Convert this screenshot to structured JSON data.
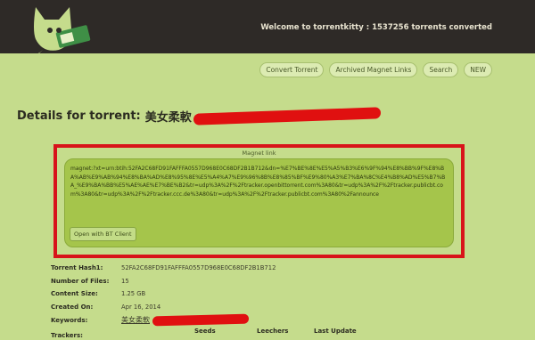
{
  "header": {
    "welcome": "Welcome to torrentkitty : 1537256 torrents converted"
  },
  "nav": {
    "items": [
      {
        "label": "Convert Torrent"
      },
      {
        "label": "Archived Magnet Links"
      },
      {
        "label": "Search"
      },
      {
        "label": "NEW"
      }
    ]
  },
  "page": {
    "title_label": "Details for torrent:",
    "torrent_name": "美女柔軟"
  },
  "magnet": {
    "caption": "Magnet link",
    "link": "magnet:?xt=urn:btih:52FA2C68FD91FAFFFA0557D968E0C68DF2B1B712&dn=%E7%BE%8E%E5%A5%B3%E6%9F%94%E8%BB%9F%E8%BA%AB%E9%AB%94%E8%BA%AD%E8%95%8E%E5%A4%A7%E9%96%8B%E8%85%BF%E9%80%A3%E7%BA%8C%E4%B8%AD%E5%B7%BA_%E9%BA%BB%E5%AE%AE%E7%BE%B2&tr=udp%3A%2F%2Ftracker.openbittorrent.com%3A80&tr=udp%3A%2F%2Ftracker.publicbt.com%3A80&tr=udp%3A%2F%2Ftracker.ccc.de%3A80&tr=udp%3A%2F%2Ftracker.publicbt.com%3A80%2Fannounce",
    "open_button": "Open with BT Client"
  },
  "details": {
    "hash_label": "Torrent Hash1:",
    "hash_value": "52FA2C68FD91FAFFFA0557D968E0C68DF2B1B712",
    "files_label": "Number of Files:",
    "files_value": "15",
    "size_label": "Content Size:",
    "size_value": "1.25 GB",
    "created_label": "Created On:",
    "created_value": "Apr 16, 2014",
    "keywords_label": "Keywords:",
    "keywords_value": "美女柔軟"
  },
  "trackers": {
    "label": "Trackers:",
    "col_seeds": "Seeds",
    "col_leechers": "Leechers",
    "col_last_update": "Last Update"
  },
  "colors": {
    "header_bg": "#2e2a27",
    "page_bg": "#c5dc8c",
    "magnet_bg": "#a5c54b",
    "highlight_border": "#d8141a",
    "redaction": "#e01010"
  }
}
